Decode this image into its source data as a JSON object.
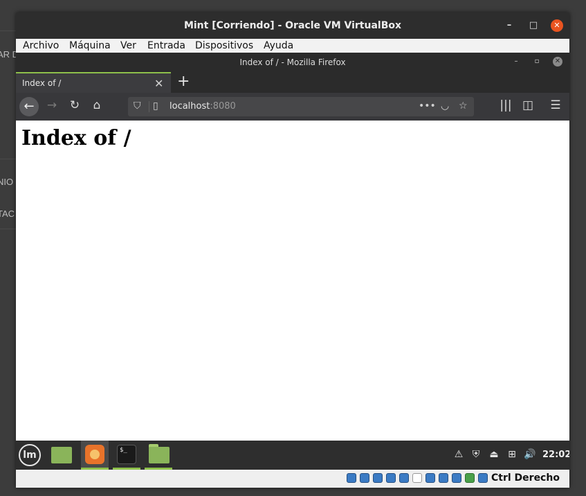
{
  "host": {
    "side_texts": [
      "AR D",
      "NIO",
      "TAC"
    ]
  },
  "vbox": {
    "title": "Mint [Corriendo] - Oracle VM VirtualBox",
    "minimize": "–",
    "maximize": "□",
    "close": "✕",
    "menu": [
      "Archivo",
      "Máquina",
      "Ver",
      "Entrada",
      "Dispositivos",
      "Ayuda"
    ],
    "host_key": "Ctrl Derecho"
  },
  "firefox": {
    "window_title": "Index of / - Mozilla Firefox",
    "tab_label": "Index of /",
    "tab_close": "✕",
    "new_tab": "+",
    "url_host": "localhost",
    "url_port": ":8080",
    "nav_icons": [
      "arrow-left-icon",
      "arrow-right-icon",
      "reload-icon",
      "home-icon"
    ],
    "toolbar_icons": [
      "library-icon",
      "sidebar-icon",
      "hamburger-menu-icon"
    ]
  },
  "page": {
    "heading": "Index of /"
  },
  "panel": {
    "clock": "22:02",
    "tray_icons": [
      "update-icon",
      "shield-icon",
      "clipboard-icon",
      "network-icon",
      "volume-icon"
    ]
  },
  "colors": {
    "accent_green": "#8ec04b",
    "close_orange": "#e95420",
    "vbox_blue": "#3b7bc4"
  }
}
